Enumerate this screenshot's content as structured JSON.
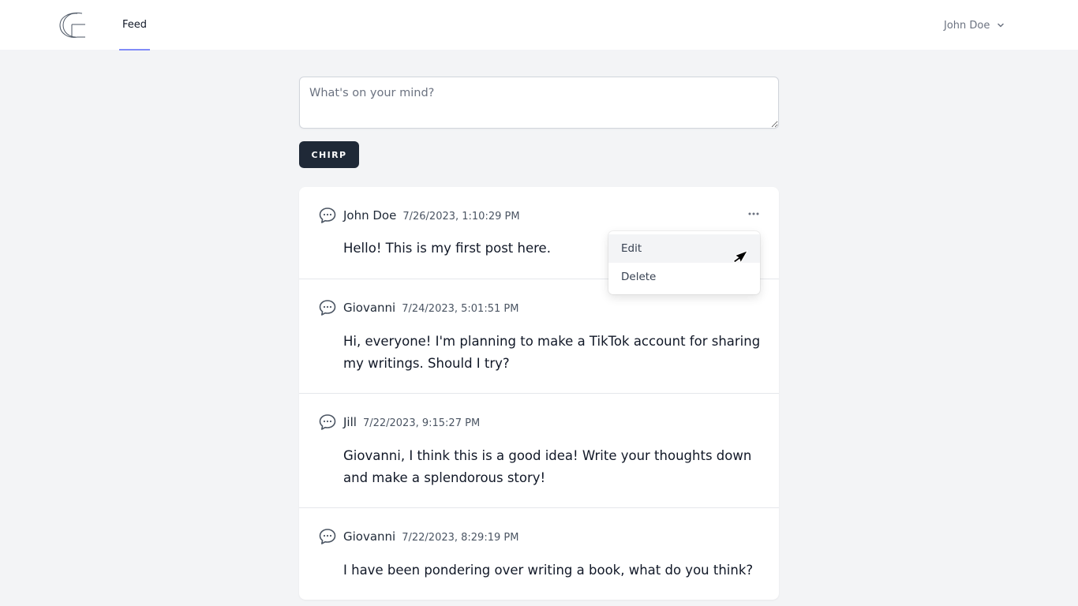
{
  "nav": {
    "logo_icon": "brand-logo-icon",
    "feed_label": "Feed",
    "user_name": "John Doe",
    "accent_color": "#818cf8"
  },
  "composer": {
    "placeholder": "What's on your mind?",
    "value": "",
    "submit_label": "CHIRP"
  },
  "feed": {
    "posts": [
      {
        "author": "John Doe",
        "date": "7/26/2023, 1:10:29 PM",
        "body": "Hello! This is my first post here."
      },
      {
        "author": "Giovanni",
        "date": "7/24/2023, 5:01:51 PM",
        "body": "Hi, everyone! I'm planning to make a TikTok account for sharing my writings. Should I try?"
      },
      {
        "author": "Jill",
        "date": "7/22/2023, 9:15:27 PM",
        "body": "Giovanni, I think this is a good idea! Write your thoughts down and make a splendorous story!"
      },
      {
        "author": "Giovanni",
        "date": "7/22/2023, 8:29:19 PM",
        "body": "I have been pondering over writing a book, what do you think?"
      }
    ]
  },
  "dropdown": {
    "items": [
      {
        "label": "Edit",
        "state": "hovered"
      },
      {
        "label": "Delete",
        "state": "normal"
      }
    ]
  },
  "colors": {
    "page_bg": "#f3f4f6",
    "button_bg": "#1f2937",
    "text_primary": "#111827",
    "text_muted": "#4b5563"
  }
}
